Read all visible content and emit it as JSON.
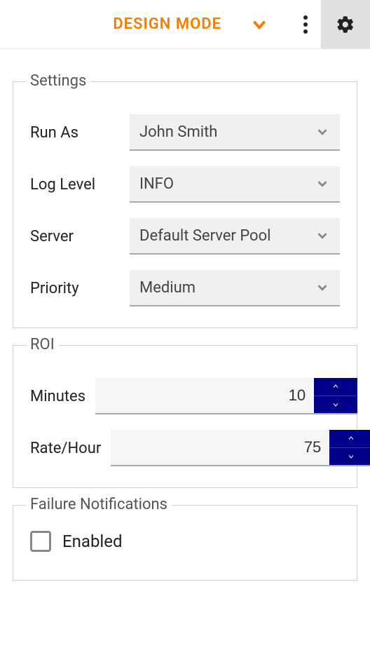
{
  "topbar": {
    "mode": "DESIGN MODE"
  },
  "settings": {
    "legend": "Settings",
    "run_as": {
      "label": "Run As",
      "value": "John Smith"
    },
    "log_level": {
      "label": "Log Level",
      "value": "INFO"
    },
    "server": {
      "label": "Server",
      "value": "Default Server Pool"
    },
    "priority": {
      "label": "Priority",
      "value": "Medium"
    }
  },
  "roi": {
    "legend": "ROI",
    "minutes": {
      "label": "Minutes",
      "value": "10"
    },
    "rate_per_hour": {
      "label": "Rate/Hour",
      "value": "75"
    }
  },
  "failure_notifications": {
    "legend": "Failure Notifications",
    "enabled": {
      "label": "Enabled",
      "checked": false
    }
  }
}
